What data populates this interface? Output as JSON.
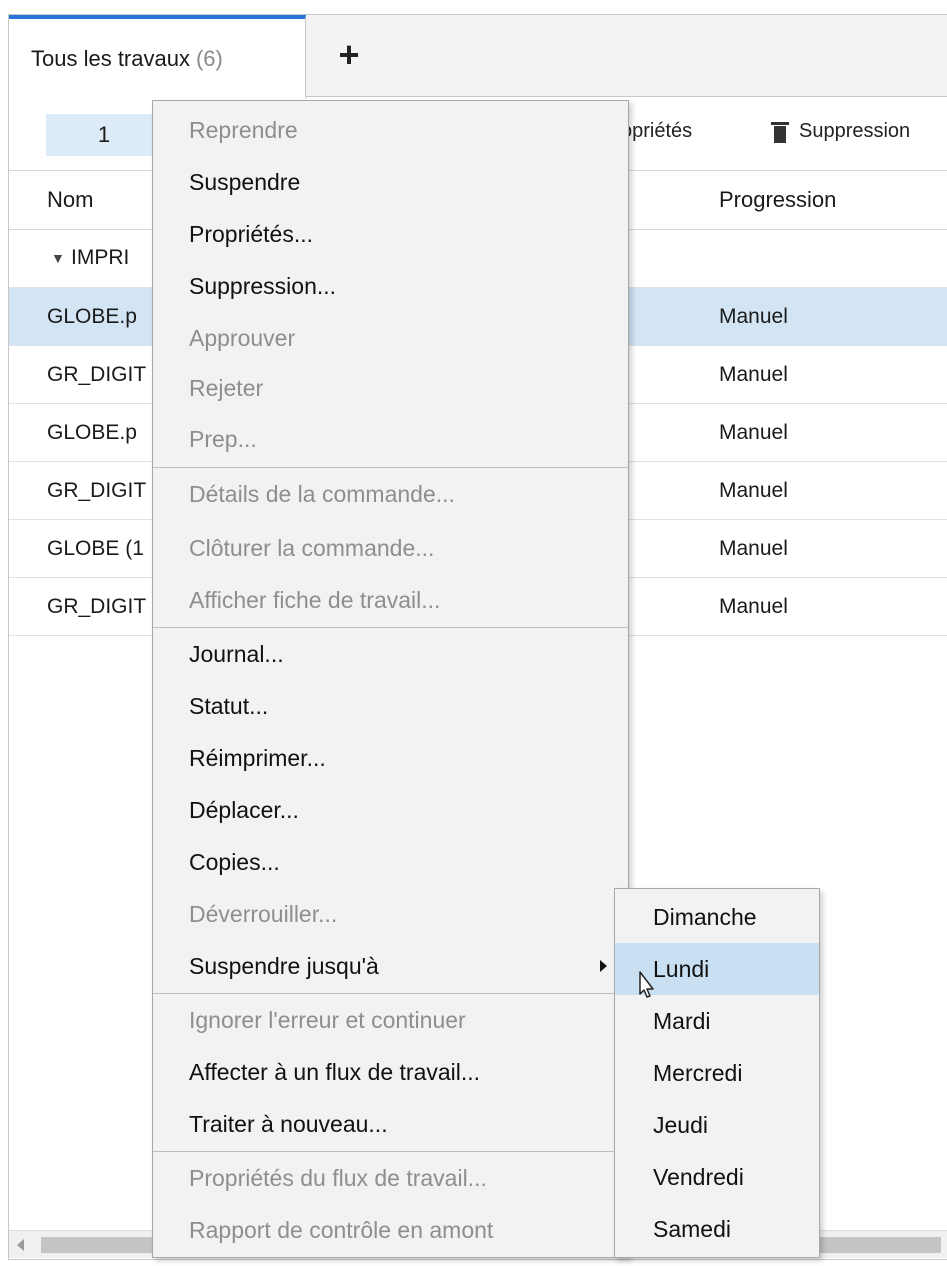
{
  "tabs": {
    "active_label": "Tous les travaux",
    "active_count": "(6)",
    "add_label": "+"
  },
  "toolbar": {
    "page_number": "1",
    "properties_label": "opriétés",
    "delete_label": "Suppression"
  },
  "table": {
    "columns": [
      "Nom",
      "Progression"
    ],
    "group_label": "IMPRI",
    "rows": [
      {
        "name": "GLOBE.p",
        "progress": "Manuel"
      },
      {
        "name": "GR_DIGIT",
        "progress": "Manuel"
      },
      {
        "name": "GLOBE.p",
        "progress": "Manuel"
      },
      {
        "name": "GR_DIGIT",
        "progress": "Manuel"
      },
      {
        "name": "GLOBE (1",
        "progress": "Manuel"
      },
      {
        "name": "GR_DIGIT",
        "progress": "Manuel"
      }
    ]
  },
  "context_menu": {
    "items": [
      {
        "label": "Reprendre",
        "enabled": false
      },
      {
        "label": "Suspendre",
        "enabled": true
      },
      {
        "label": "Propriétés...",
        "enabled": true
      },
      {
        "label": "Suppression...",
        "enabled": true
      },
      {
        "label": "Approuver",
        "enabled": false
      },
      {
        "label": "Rejeter",
        "enabled": false
      },
      {
        "label": "Prep...",
        "enabled": false
      },
      {
        "label": "Détails de la commande...",
        "enabled": false
      },
      {
        "label": "Clôturer la commande...",
        "enabled": false
      },
      {
        "label": "Afficher fiche de travail...",
        "enabled": false
      },
      {
        "label": "Journal...",
        "enabled": true
      },
      {
        "label": "Statut...",
        "enabled": true
      },
      {
        "label": "Réimprimer...",
        "enabled": true
      },
      {
        "label": "Déplacer...",
        "enabled": true
      },
      {
        "label": "Copies...",
        "enabled": true
      },
      {
        "label": "Déverrouiller...",
        "enabled": false
      },
      {
        "label": "Suspendre jusqu'à",
        "enabled": true
      },
      {
        "label": "Ignorer l'erreur et continuer",
        "enabled": false
      },
      {
        "label": "Affecter à un flux de travail...",
        "enabled": true
      },
      {
        "label": "Traiter à nouveau...",
        "enabled": true
      },
      {
        "label": "Propriétés du flux de travail...",
        "enabled": false
      },
      {
        "label": "Rapport de contrôle en amont",
        "enabled": false
      }
    ]
  },
  "submenu": {
    "items": [
      "Dimanche",
      "Lundi",
      "Mardi",
      "Mercredi",
      "Jeudi",
      "Vendredi",
      "Samedi"
    ],
    "hovered": "Lundi"
  },
  "colors": {
    "accent": "#2a73d9",
    "selection": "#d3e5f4",
    "hover": "#c9e0f2",
    "disabled_text": "#8e8e8e"
  }
}
